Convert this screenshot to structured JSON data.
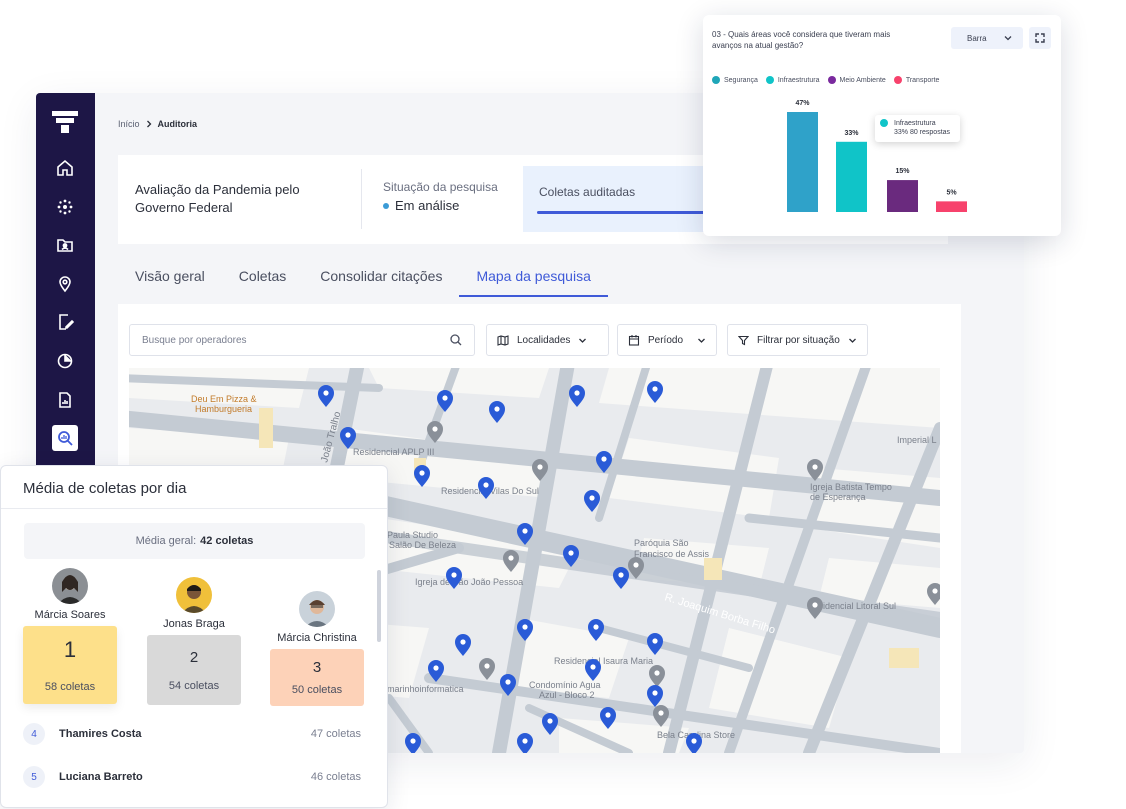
{
  "breadcrumb": {
    "home": "Início",
    "current": "Auditoria"
  },
  "header": {
    "title": "Avaliação da Pandemia pelo Governo Federal",
    "situation_label": "Situação da pesquisa",
    "situation_value": "Em análise",
    "collects_label": "Coletas auditadas"
  },
  "tabs": [
    "Visão geral",
    "Coletas",
    "Consolidar citações",
    "Mapa da pesquisa"
  ],
  "filters": {
    "search_placeholder": "Busque por operadores",
    "localidades": "Localidades",
    "periodo": "Período",
    "situacao": "Filtrar por situação"
  },
  "map_labels": {
    "pizza": "Deu Em Pizza &",
    "pizza2": "Hamburgueria",
    "aplp": "Residencial APLP III",
    "vilas": "Residencial Vilas Do Sul",
    "paula": "Paula Studio",
    "paula2": "Salão De Beleza",
    "igreja": "Igreja de São João Pessoa",
    "paroquia": "Paróquia São",
    "paroquia2": "Francisco de Assis",
    "batista": "Igreja Batista Tempo",
    "batista2": "de Esperança",
    "imperial": "Imperial L",
    "joaquim": "R. Joaquim Borba Filho",
    "litoral": "Residencial Litoral Sul",
    "isaura": "Residencial Isaura Maria",
    "info": "marinhoinformatica",
    "condominio": "Condomínio Agua",
    "condominio2": "Azul - Bloco 2",
    "bela": "Bela Carolina Store",
    "joao_street": "João Tralho"
  },
  "chart_card": {
    "question": "03 - Quais áreas você considera que tiveram mais avanços na atual gestão?",
    "select_value": "Barra",
    "tooltip_title": "Infraestrutura",
    "tooltip_text": "33% 80 respostas"
  },
  "chart_data": {
    "type": "bar",
    "categories": [
      "Segurança",
      "Infraestrutura",
      "Meio Ambiente",
      "Transporte"
    ],
    "values": [
      47,
      33,
      15,
      5
    ],
    "value_labels": [
      "47%",
      "33%",
      "15%",
      "5%"
    ],
    "colors": [
      "#2fa2c9",
      "#10c4c8",
      "#6a2a7e",
      "#f7426c"
    ],
    "legend_colors": [
      "#1fa6b8",
      "#10c4c8",
      "#7a2a9e",
      "#f7426c"
    ],
    "ylim": [
      0,
      47
    ]
  },
  "ranking": {
    "title": "Média de coletas por dia",
    "avg_label": "Média geral:",
    "avg_value": "42 coletas",
    "podium": [
      {
        "name": "Márcia Soares",
        "position": "1",
        "count": "58 coletas",
        "color": "#fde08a"
      },
      {
        "name": "Jonas Braga",
        "position": "2",
        "count": "54 coletas",
        "color": "#d9d9d9"
      },
      {
        "name": "Márcia Christina",
        "position": "3",
        "count": "50 coletas",
        "color": "#fdd2b8"
      }
    ],
    "rows": [
      {
        "position": "4",
        "name": "Thamires Costa",
        "count": "47 coletas"
      },
      {
        "position": "5",
        "name": "Luciana Barreto",
        "count": "46 coletas"
      }
    ]
  }
}
